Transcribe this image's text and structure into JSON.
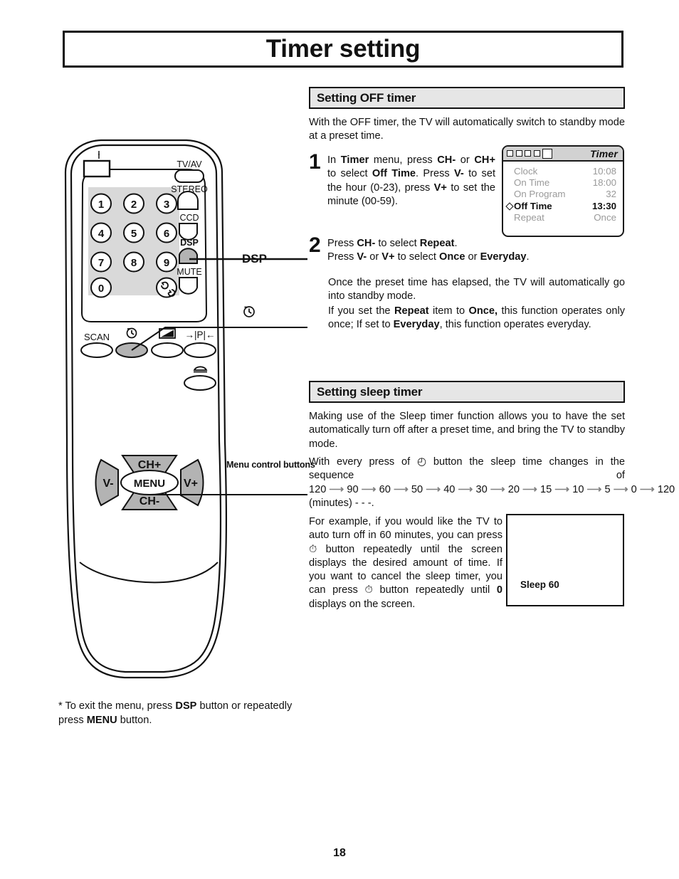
{
  "page": {
    "title": "Timer setting",
    "number": "18"
  },
  "sections": {
    "off_timer": {
      "heading": "Setting OFF timer",
      "intro": "With the OFF timer, the TV will automatically switch to standby mode at a preset time.",
      "steps": [
        {
          "number": "1",
          "text_parts": [
            {
              "t": "In ",
              "b": false
            },
            {
              "t": "Timer",
              "b": true
            },
            {
              "t": " menu, press ",
              "b": false
            },
            {
              "t": "CH-",
              "b": true
            },
            {
              "t": " or ",
              "b": false
            },
            {
              "t": "CH+",
              "b": true
            },
            {
              "t": " to select ",
              "b": false
            },
            {
              "t": "Off  Time",
              "b": true
            },
            {
              "t": ". Press ",
              "b": false
            },
            {
              "t": "V-",
              "b": true
            },
            {
              "t": " to set the hour (0-23), press  ",
              "b": false
            },
            {
              "t": "V+",
              "b": true
            },
            {
              "t": " to set the minute (00-59).",
              "b": false
            }
          ]
        },
        {
          "number": "2",
          "text_parts": [
            {
              "t": "Press  ",
              "b": false
            },
            {
              "t": "CH-",
              "b": true
            },
            {
              "t": "  to select ",
              "b": false
            },
            {
              "t": "Repeat",
              "b": true
            },
            {
              "t": ".\nPress ",
              "b": false
            },
            {
              "t": "V-",
              "b": true
            },
            {
              "t": " or ",
              "b": false
            },
            {
              "t": "V+",
              "b": true
            },
            {
              "t": " to select ",
              "b": false
            },
            {
              "t": "Once",
              "b": true
            },
            {
              "t": " or ",
              "b": false
            },
            {
              "t": "Everyday",
              "b": true
            },
            {
              "t": ".",
              "b": false
            }
          ]
        }
      ],
      "note_1": "Once the preset time has elapsed, the TV will automatically go into standby mode.",
      "note_2_parts": [
        {
          "t": "If you set the ",
          "b": false
        },
        {
          "t": "Repeat",
          "b": true
        },
        {
          "t": " item to ",
          "b": false
        },
        {
          "t": "Once,",
          "b": true
        },
        {
          "t": " this function operates only once; If set to ",
          "b": false
        },
        {
          "t": "Everyday",
          "b": true
        },
        {
          "t": ", this function operates everyday.",
          "b": false
        }
      ]
    },
    "sleep_timer": {
      "heading": "Setting sleep timer",
      "intro": "Making use of the Sleep timer function allows you to have the set automatically turn off after a preset time, and bring the TV to standby mode.",
      "sequence_lead_before": "With every press of ",
      "sequence_lead_after": " button the sleep time changes in the sequence of ",
      "sequence_values": [
        "120",
        "90",
        "60",
        "50",
        "40",
        "30",
        "20",
        "15",
        "10",
        "5",
        "0",
        "120"
      ],
      "sequence_suffix": "(minutes) - - -.",
      "example_parts": [
        {
          "t": "For example, if you would like the TV to auto turn off in 60 minutes, you can press ",
          "b": false
        },
        {
          "t": "⏱",
          "b": false,
          "icon": "clock-icon"
        },
        {
          "t": " button repeatedly until the screen displays the desired amount of time. If you want to cancel the sleep timer, you can press ",
          "b": false
        },
        {
          "t": "⏱",
          "b": false,
          "icon": "clock-icon"
        },
        {
          "t": " button repeatedly until ",
          "b": false
        },
        {
          "t": "0",
          "b": true
        },
        {
          "t": " displays on the screen.",
          "b": false
        }
      ]
    }
  },
  "osd": {
    "title": "Timer",
    "tab_count_small": 4,
    "tab_count_large": 1,
    "rows": [
      {
        "label": "Clock",
        "value": "10:08",
        "selected": false
      },
      {
        "label": "On Time",
        "value": "18:00",
        "selected": false
      },
      {
        "label": "On Program",
        "value": "32",
        "selected": false
      },
      {
        "label": "Off Time",
        "value": "13:30",
        "selected": true
      },
      {
        "label": "Repeat",
        "value": "Once",
        "selected": false
      }
    ]
  },
  "sleep_preview": {
    "label": "Sleep 60"
  },
  "footnote_parts": [
    {
      "t": "* To exit the menu, press ",
      "b": false
    },
    {
      "t": "DSP",
      "b": true
    },
    {
      "t": " button or repeatedly press ",
      "b": false
    },
    {
      "t": "MENU",
      "b": true
    },
    {
      "t": " button.",
      "b": false
    }
  ],
  "remote": {
    "callouts": {
      "dsp": "DSP",
      "menu_control": "Menu control buttons"
    },
    "buttons": {
      "power": "power-icon",
      "tv_av": "TV/AV",
      "stereo": "STEREO",
      "ccd": "CCD",
      "dsp": "DSP",
      "mute": "MUTE",
      "scan": "SCAN",
      "sleep": "clock-icon",
      "picture": "picture-icon",
      "prev_prog": "→|P|←",
      "sound": "sound-icon",
      "ch_up": "CH+",
      "ch_down": "CH-",
      "vol_down": "V-",
      "vol_up": "V+",
      "menu": "MENU",
      "numbers": [
        "1",
        "2",
        "3",
        "4",
        "5",
        "6",
        "7",
        "8",
        "9",
        "0"
      ],
      "recall": "recall-icon"
    }
  },
  "colors": {
    "ink": "#111111",
    "head_fill": "#e6e6e6",
    "osd_head_fill": "#d2d2d2",
    "osd_dim": "#9a9a9a",
    "keypad_fill": "#d9d9d9",
    "button_fill": "#b3b3b3",
    "arrow_gray": "#808080"
  }
}
